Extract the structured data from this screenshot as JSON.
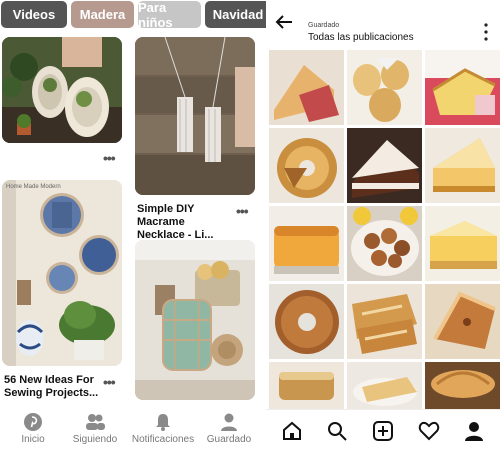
{
  "pinterest": {
    "chips": [
      "Videos",
      "Madera",
      "Para niños",
      "Navidad"
    ],
    "pins": [
      {
        "title": ""
      },
      {
        "title": "Simple DIY Macrame Necklace - Li..."
      },
      {
        "title": "56 New Ideas For Sewing Projects...",
        "watermark": "Home Made Modern"
      },
      {
        "title": ""
      }
    ],
    "more_glyph": "•••",
    "nav": [
      "Inicio",
      "Siguiendo",
      "Notificaciones",
      "Guardado"
    ],
    "colors": {
      "pinterest_red": "#e60023",
      "nav_gray": "#8a8a8a"
    }
  },
  "instagram": {
    "header": {
      "back_icon": "arrow-left-icon",
      "subtitle": "Guardado",
      "title": "Todas las publicaciones"
    },
    "grid": [
      [
        "cake-slices",
        "cream-puffs",
        "sliced-bread"
      ],
      [
        "bundt-cake",
        "chocolate-cake",
        "cheesecake-slice"
      ],
      [
        "orange-sponge-cake",
        "cookies-plate",
        "lemon-bars"
      ],
      [
        "ring-cake",
        "apple-pastry",
        "pie-slice"
      ],
      [
        "loaf-cake",
        "cake-plate",
        "croissant"
      ]
    ],
    "nav_icons": [
      "home-icon",
      "search-icon",
      "add-post-icon",
      "heart-icon",
      "profile-icon"
    ]
  }
}
